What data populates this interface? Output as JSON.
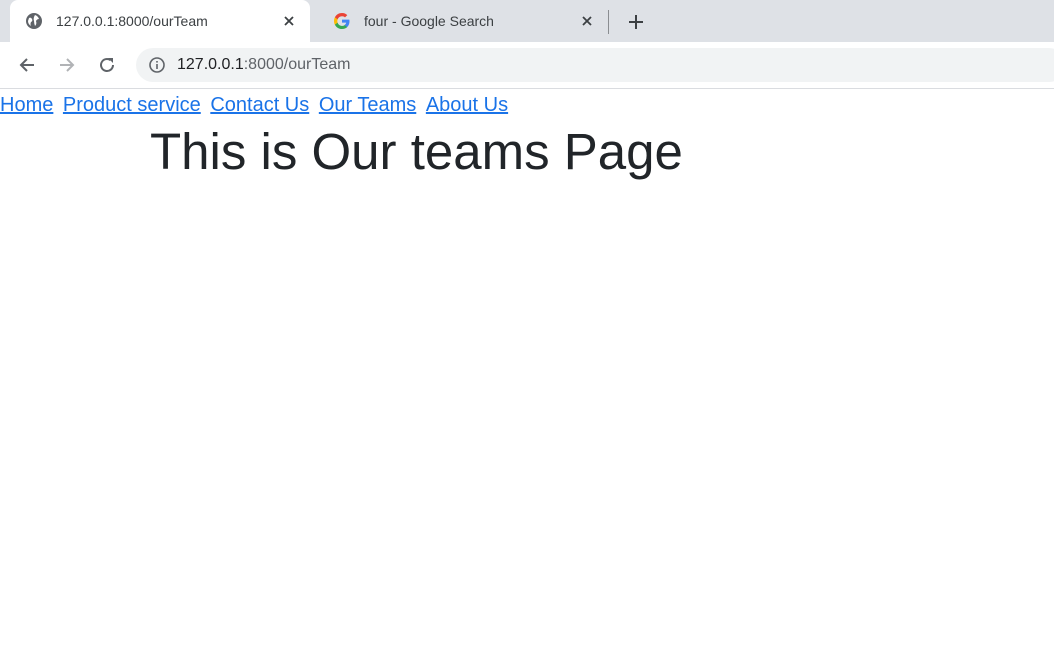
{
  "browser": {
    "tabs": [
      {
        "title": "127.0.0.1:8000/ourTeam",
        "icon": "globe-icon",
        "active": true
      },
      {
        "title": "four - Google Search",
        "icon": "google-g-icon",
        "active": false
      }
    ],
    "address_bar": {
      "host": "127.0.0.1",
      "path": ":8000/ourTeam"
    }
  },
  "page": {
    "nav_links": [
      "Home",
      "Product service",
      "Contact Us",
      "Our Teams",
      "About Us"
    ],
    "heading": "This is Our teams Page"
  },
  "colors": {
    "link": "#1a73e8",
    "heading": "#212529",
    "tabstrip": "#dee1e6",
    "omnibox": "#f1f3f4"
  }
}
